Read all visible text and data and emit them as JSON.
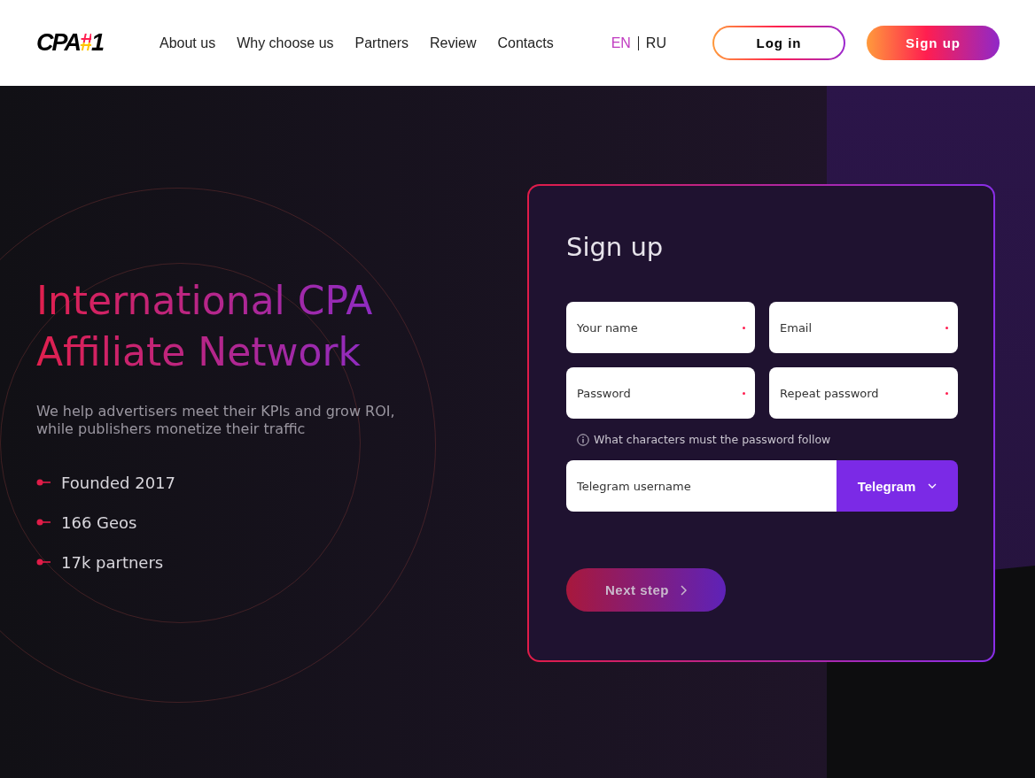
{
  "logo": {
    "text": "CPA",
    "mark": "#",
    "tail": "1"
  },
  "nav": [
    "About us",
    "Why choose us",
    "Partners",
    "Review",
    "Contacts"
  ],
  "languages": [
    {
      "label": "EN",
      "selected": true
    },
    {
      "label": "RU",
      "selected": false
    }
  ],
  "header_buttons": [
    {
      "label": "Log in",
      "kind": "outline"
    },
    {
      "label": "Sign up",
      "kind": "filled"
    }
  ],
  "hero": {
    "title_lines": [
      "International CPA",
      "Affiliate Network"
    ],
    "subtitle": "We help advertisers meet their KPIs and grow ROI, while publishers monetize their traffic",
    "facts": [
      "Founded 2017",
      "166 Geos",
      "17k partners"
    ]
  },
  "form": {
    "title": "Sign up",
    "fields": [
      {
        "placeholder": "Your name",
        "required": true
      },
      {
        "placeholder": "Email",
        "required": true
      },
      {
        "placeholder": "Password",
        "required": true
      },
      {
        "placeholder": "Repeat password",
        "required": true
      }
    ],
    "hint": "What characters must the password follow",
    "messenger": {
      "placeholder": "Telegram username",
      "selector": "Telegram"
    },
    "next": "Next step"
  }
}
